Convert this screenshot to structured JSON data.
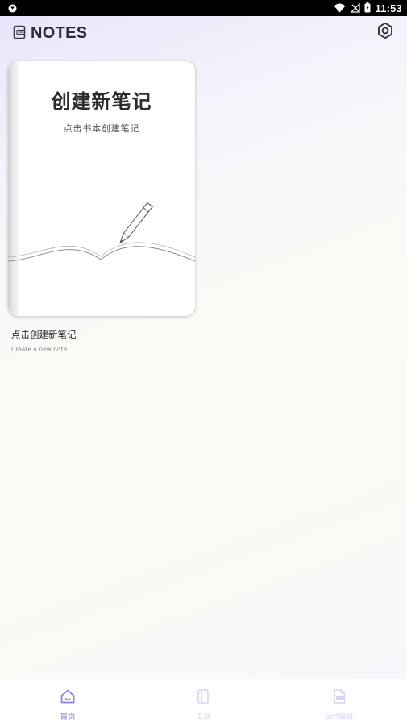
{
  "status_bar": {
    "time": "11:53",
    "icons": [
      "app-notification-icon",
      "wifi-icon",
      "no-signal-icon",
      "battery-icon"
    ]
  },
  "header": {
    "title": "NOTES",
    "icons": [
      "notes-logo-icon",
      "settings-icon"
    ]
  },
  "notebook": {
    "cover_title": "创建新笔记",
    "cover_subtitle": "点击书本创建笔记",
    "caption": "点击创建新笔记",
    "subcaption": "Create a new note"
  },
  "bottom_nav": {
    "items": [
      {
        "label": "首页",
        "icon": "home-icon",
        "active": true
      },
      {
        "label": "工具",
        "icon": "notebook-icon",
        "active": false
      },
      {
        "label": "pdf编辑",
        "icon": "pdf-file-icon",
        "active": false
      }
    ]
  },
  "colors": {
    "accent": "#8b7ff0",
    "inactive_nav": "#d9d4f3",
    "title_text": "#2b2b36"
  }
}
